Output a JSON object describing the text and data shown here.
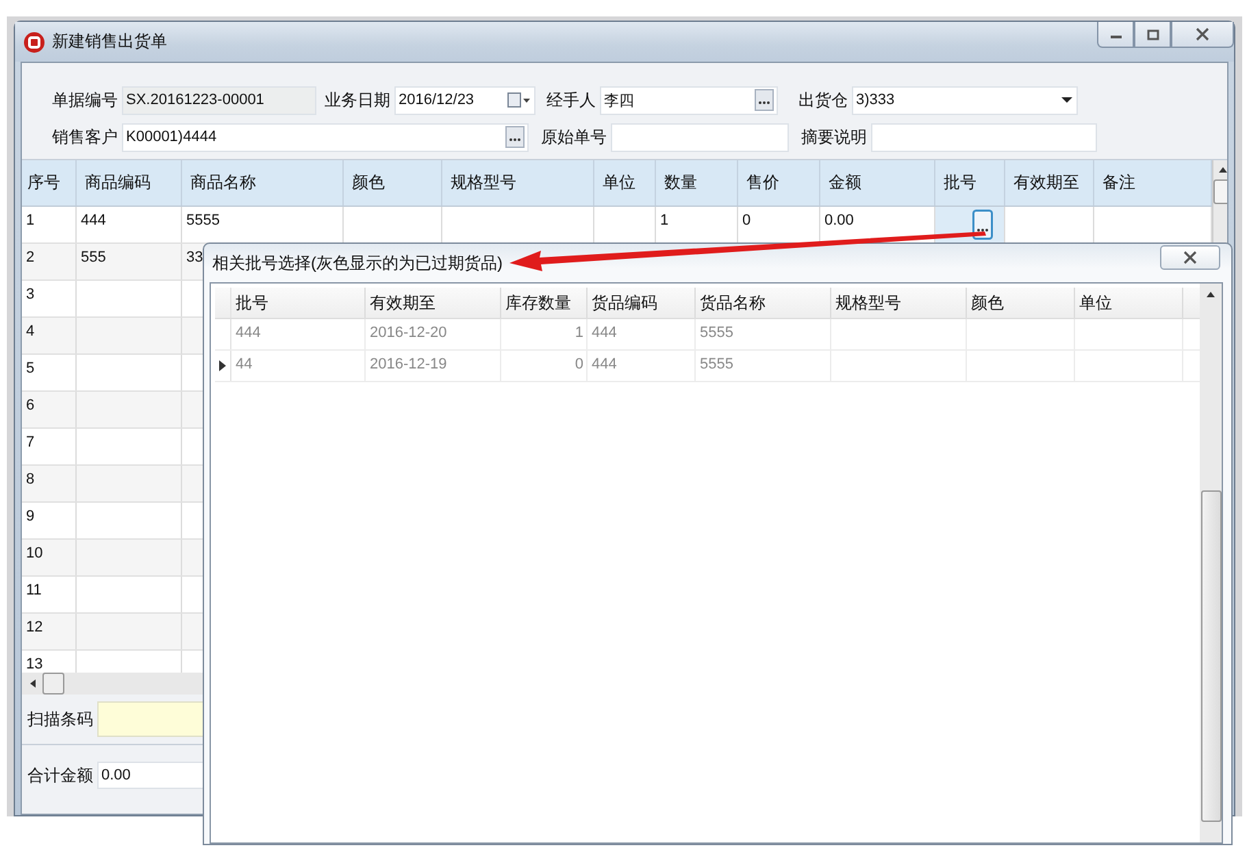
{
  "window": {
    "title": "新建销售出货单"
  },
  "form": [
    [
      {
        "label": "单据编号",
        "value": "SX.20161223-00001",
        "kind": "readonly"
      },
      {
        "label": "业务日期",
        "value": "2016/12/23",
        "kind": "date"
      },
      {
        "label": "经手人",
        "value": "李四",
        "kind": "lookup"
      },
      {
        "label": "出货仓",
        "value": "3)333",
        "kind": "dropdown"
      }
    ],
    [
      {
        "label": "销售客户",
        "value": "K00001)4444",
        "kind": "lookup"
      },
      {
        "label": "原始单号",
        "kind": "text"
      },
      {
        "label": "摘要说明",
        "kind": "text"
      }
    ]
  ],
  "grid": {
    "columns": [
      "序号",
      "商品编码",
      "商品名称",
      "颜色",
      "规格型号",
      "单位",
      "数量",
      "售价",
      "金额",
      "批号",
      "有效期至",
      "备注"
    ],
    "rows": [
      {
        "cells": [
          "1",
          "444",
          "5555",
          "",
          "",
          "",
          "1",
          "0",
          "0.00"
        ],
        "batch_button": true
      },
      {
        "cells": [
          "2",
          "555",
          "33"
        ]
      },
      {
        "cells": [
          "3"
        ]
      },
      {
        "cells": [
          "4"
        ]
      },
      {
        "cells": [
          "5"
        ]
      },
      {
        "cells": [
          "6"
        ]
      },
      {
        "cells": [
          "7"
        ]
      },
      {
        "cells": [
          "8"
        ]
      },
      {
        "cells": [
          "9"
        ]
      },
      {
        "cells": [
          "10"
        ]
      },
      {
        "cells": [
          "11"
        ]
      },
      {
        "cells": [
          "12"
        ]
      },
      {
        "cells": [
          "13"
        ]
      }
    ]
  },
  "scan": {
    "label": "扫描条码"
  },
  "total": {
    "label": "合计金额",
    "value": "0.00"
  },
  "dialog": {
    "title": "相关批号选择(灰色显示的为已过期货品)",
    "columns": [
      "批号",
      "有效期至",
      "库存数量",
      "货品编码",
      "货品名称",
      "规格型号",
      "颜色",
      "单位"
    ],
    "rows": [
      {
        "cells": [
          "444",
          "2016-12-20",
          "1",
          "444",
          "5555"
        ],
        "expired": true,
        "current": false
      },
      {
        "cells": [
          "44",
          "2016-12-19",
          "0",
          "444",
          "5555"
        ],
        "expired": true,
        "current": true
      }
    ]
  }
}
